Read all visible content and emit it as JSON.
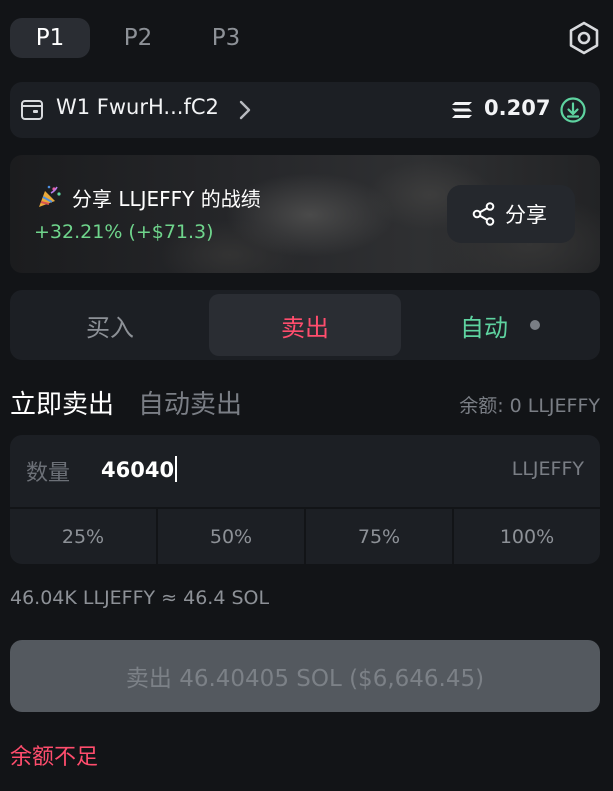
{
  "profiles": {
    "tabs": [
      {
        "label": "P1",
        "active": true
      },
      {
        "label": "P2",
        "active": false
      },
      {
        "label": "P3",
        "active": false
      }
    ],
    "settings_icon": "hexagon-gear-icon"
  },
  "wallet": {
    "icon": "wallet-icon",
    "name": "W1 FwurH...fC2",
    "chevron_icon": "chevron-right-icon",
    "chain_icon": "solana-icon",
    "balance": "0.207",
    "action_icon": "download-icon"
  },
  "share_banner": {
    "icon": "party-popper-icon",
    "title": "分享 LLJEFFY 的战绩",
    "pnl": "+32.21% (+$71.3)",
    "share_button": {
      "icon": "share-icon",
      "label": "分享"
    }
  },
  "trade_modes": {
    "buy": "买入",
    "sell": "卖出",
    "auto": "自动",
    "active": "sell"
  },
  "order_types": {
    "instant": "立即卖出",
    "auto": "自动卖出"
  },
  "balance_text": "余额: 0 LLJEFFY",
  "amount": {
    "label": "数量",
    "value": "46040",
    "unit": "LLJEFFY",
    "presets": [
      "25%",
      "50%",
      "75%",
      "100%"
    ]
  },
  "estimate": "46.04K LLJEFFY ≈ 46.4 SOL",
  "submit_label": "卖出 46.40405 SOL ($6,646.45)",
  "error": "余额不足",
  "colors": {
    "background": "#121417",
    "panel": "#1c1f24",
    "sell": "#ff4d6d",
    "auto": "#5ed3a0",
    "profit": "#6fd58c",
    "disabled_button": "#54595f"
  }
}
